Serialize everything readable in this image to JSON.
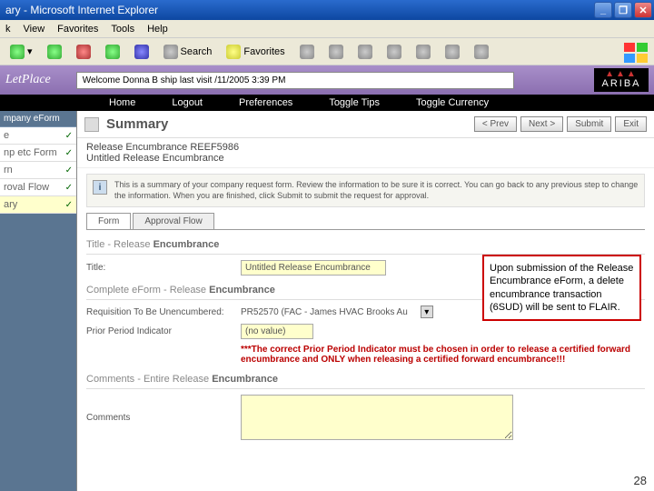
{
  "titlebar": {
    "title": "ary - Microsoft Internet Explorer"
  },
  "menubar": {
    "items": [
      "k",
      "View",
      "Favorites",
      "Tools",
      "Help"
    ]
  },
  "toolbar": {
    "search": "Search",
    "favorites": "Favorites"
  },
  "welcome": "Welcome Donna B ship last visit /11/2005 3:39 PM",
  "ariba": "ARIBA",
  "blackbar": {
    "home": "Home",
    "logout": "Logout",
    "prefs": "Preferences",
    "tips": "Toggle Tips",
    "currency": "Toggle Currency"
  },
  "sidebar": {
    "header": "mpany eForm",
    "items": [
      {
        "label": "e",
        "check": "✓"
      },
      {
        "label": "np etc Form",
        "check": "✓"
      },
      {
        "label": "rn",
        "check": "✓"
      },
      {
        "label": "roval Flow",
        "check": "✓"
      },
      {
        "label": "ary",
        "check": "✓"
      }
    ]
  },
  "summary": {
    "title": "Summary",
    "btn_prev": "< Prev",
    "btn_next": "Next >",
    "btn_submit": "Submit",
    "btn_exit": "Exit",
    "sub1": "Release Encumbrance REEF5986",
    "sub2": "Untitled Release Encumbrance",
    "info": "This is a summary of your company request form. Review the information to be sure it is correct. You can go back to any previous step to change the information. When you are finished, click Submit to submit the request for approval."
  },
  "tabs": {
    "form": "Form",
    "approval": "Approval Flow"
  },
  "section_title": {
    "label": "Title - Release ",
    "bold": "Encumbrance"
  },
  "title_field": {
    "label": "Title:",
    "value": "Untitled Release Encumbrance"
  },
  "section_complete": {
    "label": "Complete eForm - Release ",
    "bold": "Encumbrance"
  },
  "req_field": {
    "label": "Requisition To Be Unencumbered:",
    "value": "PR52570 (FAC - James HVAC Brooks Au"
  },
  "prior_field": {
    "label": "Prior Period Indicator",
    "value": "(no value)"
  },
  "warning": "***The correct Prior Period Indicator must be chosen in order to release a certified forward encumbrance and ONLY when releasing a certified forward encumbrance!!!",
  "section_comments": {
    "pre": "Comments - ",
    "mid": "Entire Release ",
    "bold": "Encumbrance"
  },
  "comments_label": "Comments",
  "callout": "Upon submission of the Release Encumbrance eForm, a delete encumbrance transaction (6SUD) will be sent to FLAIR.",
  "slidenum": "28"
}
